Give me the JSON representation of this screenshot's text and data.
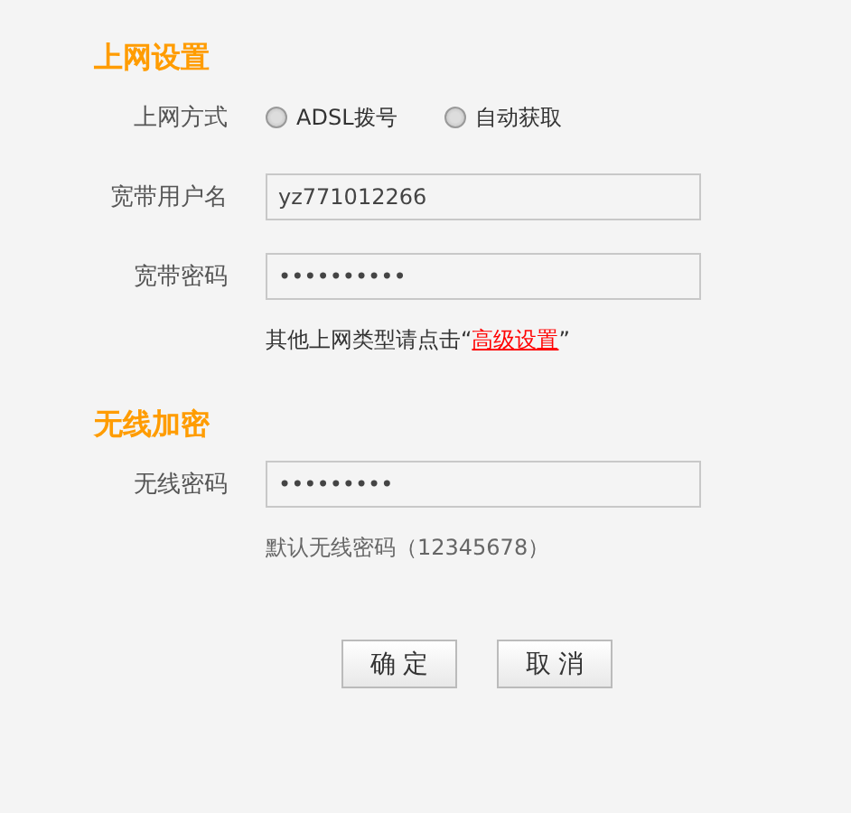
{
  "sections": [
    {
      "title": "上网设置",
      "rows": [
        {
          "kind": "radio",
          "label": "上网方式",
          "options": [
            {
              "label": "ADSL拨号",
              "selected": false
            },
            {
              "label": "自动获取",
              "selected": false
            }
          ]
        },
        {
          "kind": "field",
          "label": "宽带用户名",
          "value": "yz771012266"
        },
        {
          "kind": "field",
          "label": "宽带密码",
          "value": "••••••••••"
        },
        {
          "kind": "note",
          "text": "其他上网类型请点击“",
          "link": "高级设置",
          "after": "”"
        }
      ]
    },
    {
      "title": "无线加密",
      "rows": [
        {
          "kind": "field",
          "label": "无线密码",
          "value": "•••••••••"
        },
        {
          "kind": "note",
          "text": "默认无线密码（12345678）"
        }
      ]
    }
  ],
  "buttons": [
    "确 定",
    "取 消"
  ]
}
